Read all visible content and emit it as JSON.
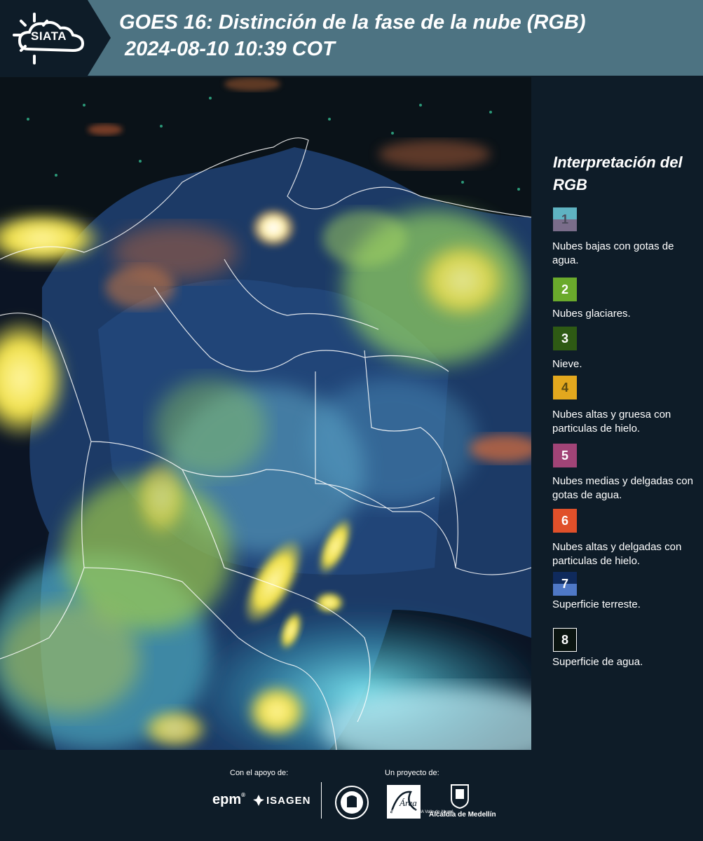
{
  "header": {
    "logo_text": "SIATA",
    "title_line1": "GOES 16: Distinción de la fase de la nube (RGB)",
    "title_line2": "2024-08-10 10:39 COT"
  },
  "legend": {
    "title": "Interpretación del RGB",
    "items": [
      {
        "number": "1",
        "label": "Nubes bajas con gotas de agua.",
        "color_top": "#5fb3c2",
        "color_bottom": "#7a6d8a",
        "number_color": "#4a4a5a"
      },
      {
        "number": "2",
        "label": "Nubes glaciares.",
        "color_top": "#6aaa2c",
        "color_bottom": "#6aaa2c",
        "number_color": "#ffffff"
      },
      {
        "number": "3",
        "label": "Nieve.",
        "color_top": "#2e5a14",
        "color_bottom": "#2e5a14",
        "number_color": "#ffffff"
      },
      {
        "number": "4",
        "label": "Nubes altas y gruesa con particulas de hielo.",
        "color_top": "#e3a81e",
        "color_bottom": "#e3a81e",
        "number_color": "#5a4a10"
      },
      {
        "number": "5",
        "label": "Nubes medias y delgadas con gotas de agua.",
        "color_top": "#a14477",
        "color_bottom": "#a14477",
        "number_color": "#ffffff"
      },
      {
        "number": "6",
        "label": "Nubes altas y delgadas con particulas de hielo.",
        "color_top": "#e0502a",
        "color_bottom": "#e0502a",
        "number_color": "#ffffff"
      },
      {
        "number": "7",
        "label": "Superficie terreste.",
        "color_top": "#0f2a5c",
        "color_bottom": "#4f78c6",
        "number_color": "#ffffff"
      },
      {
        "number": "8",
        "label": "Superficie de agua.",
        "color_top": "#0a1410",
        "color_bottom": "#0a1410",
        "number_color": "#ffffff"
      }
    ]
  },
  "footer": {
    "support_caption": "Con el apoyo de:",
    "project_caption": "Un proyecto de:",
    "sponsor_1": "epm",
    "sponsor_2": "ISAGEN",
    "partner_area": "Área",
    "partner_area_sub": "METROPOLITANA Valle de Aburrá",
    "partner_alcaldia": "Alcaldía de Medellín"
  },
  "colors": {
    "header_bg": "#4d7382",
    "page_bg": "#0e1c28",
    "map_bg": "#0b1a2c"
  }
}
